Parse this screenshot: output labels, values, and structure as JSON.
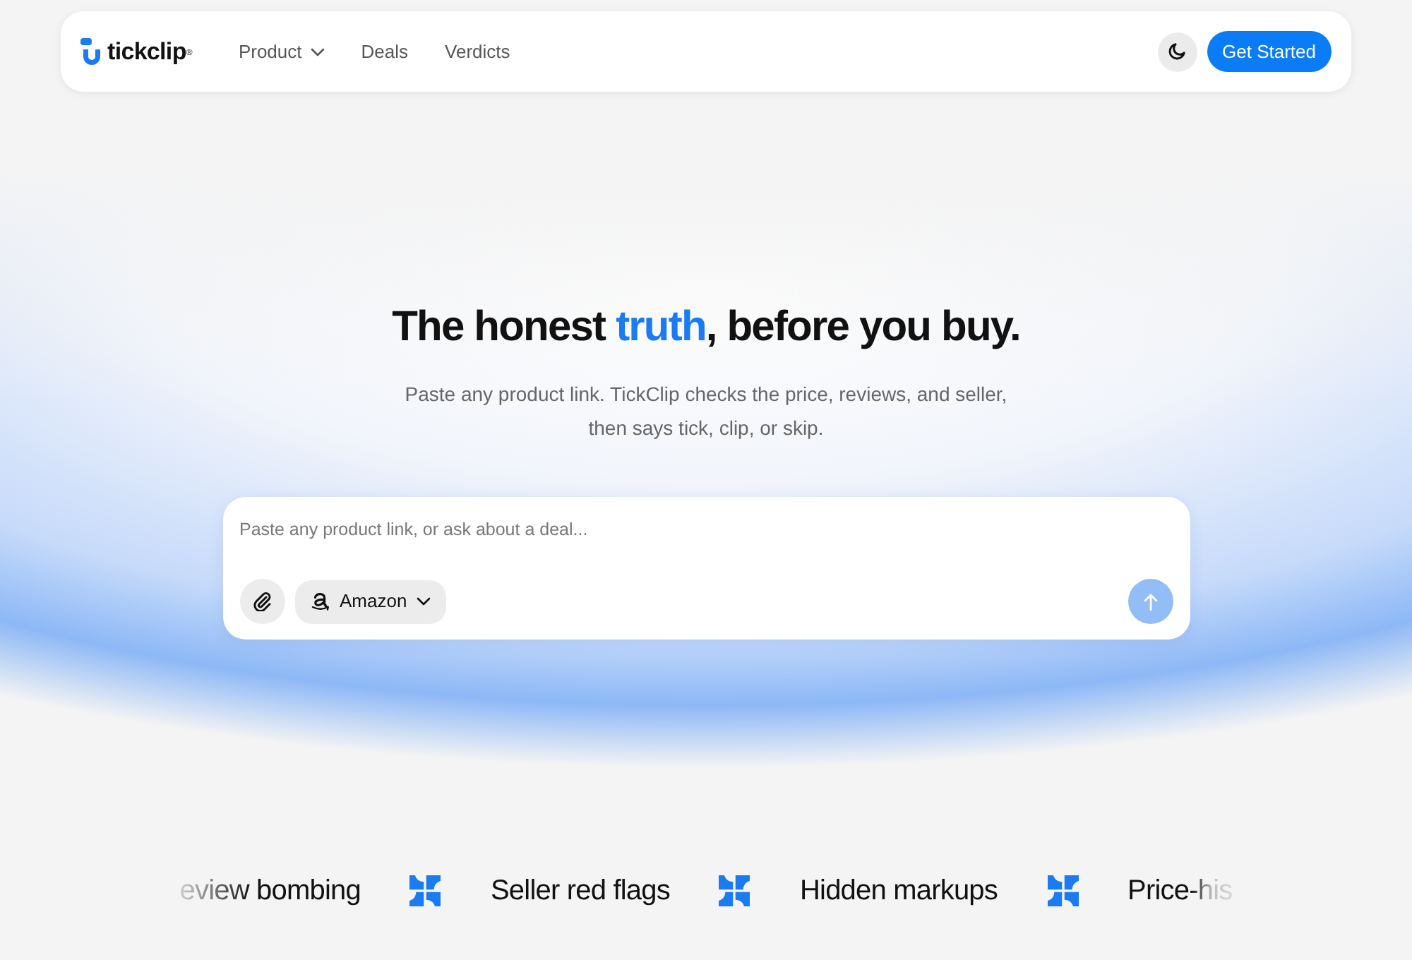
{
  "navbar": {
    "logo": "tickclip$^{®}$",
    "links": [
      {
        "label": "Product",
        "kind": "dropdown"
      },
      {
        "label": "Deals",
        "kind": "link"
      },
      {
        "label": "Verdicts",
        "kind": "link"
      }
    ],
    "cta": "Get Started"
  },
  "hero": {
    "headline": [
      {
        "text": "The honest ",
        "kind": "plain"
      },
      {
        "text": "truth",
        "kind": "accent"
      },
      {
        "text": ", before you buy.",
        "kind": "plain"
      }
    ],
    "subtitle": "Paste any product link. TickClip checks the price, reviews, and seller, then says tick, clip, or skip."
  },
  "prompt_box": {
    "placeholder": "Paste any product link, or ask about a deal...",
    "store": "Amazon",
    "send_disabled": true
  },
  "marquee": [
    {
      "text": "eview bombing",
      "kind": "fade-start"
    },
    {
      "text": "Seller red flags",
      "kind": "plain"
    },
    {
      "text": "Hidden markups",
      "kind": "plain"
    },
    {
      "text": "Price-his",
      "kind": "fade-end"
    }
  ]
}
